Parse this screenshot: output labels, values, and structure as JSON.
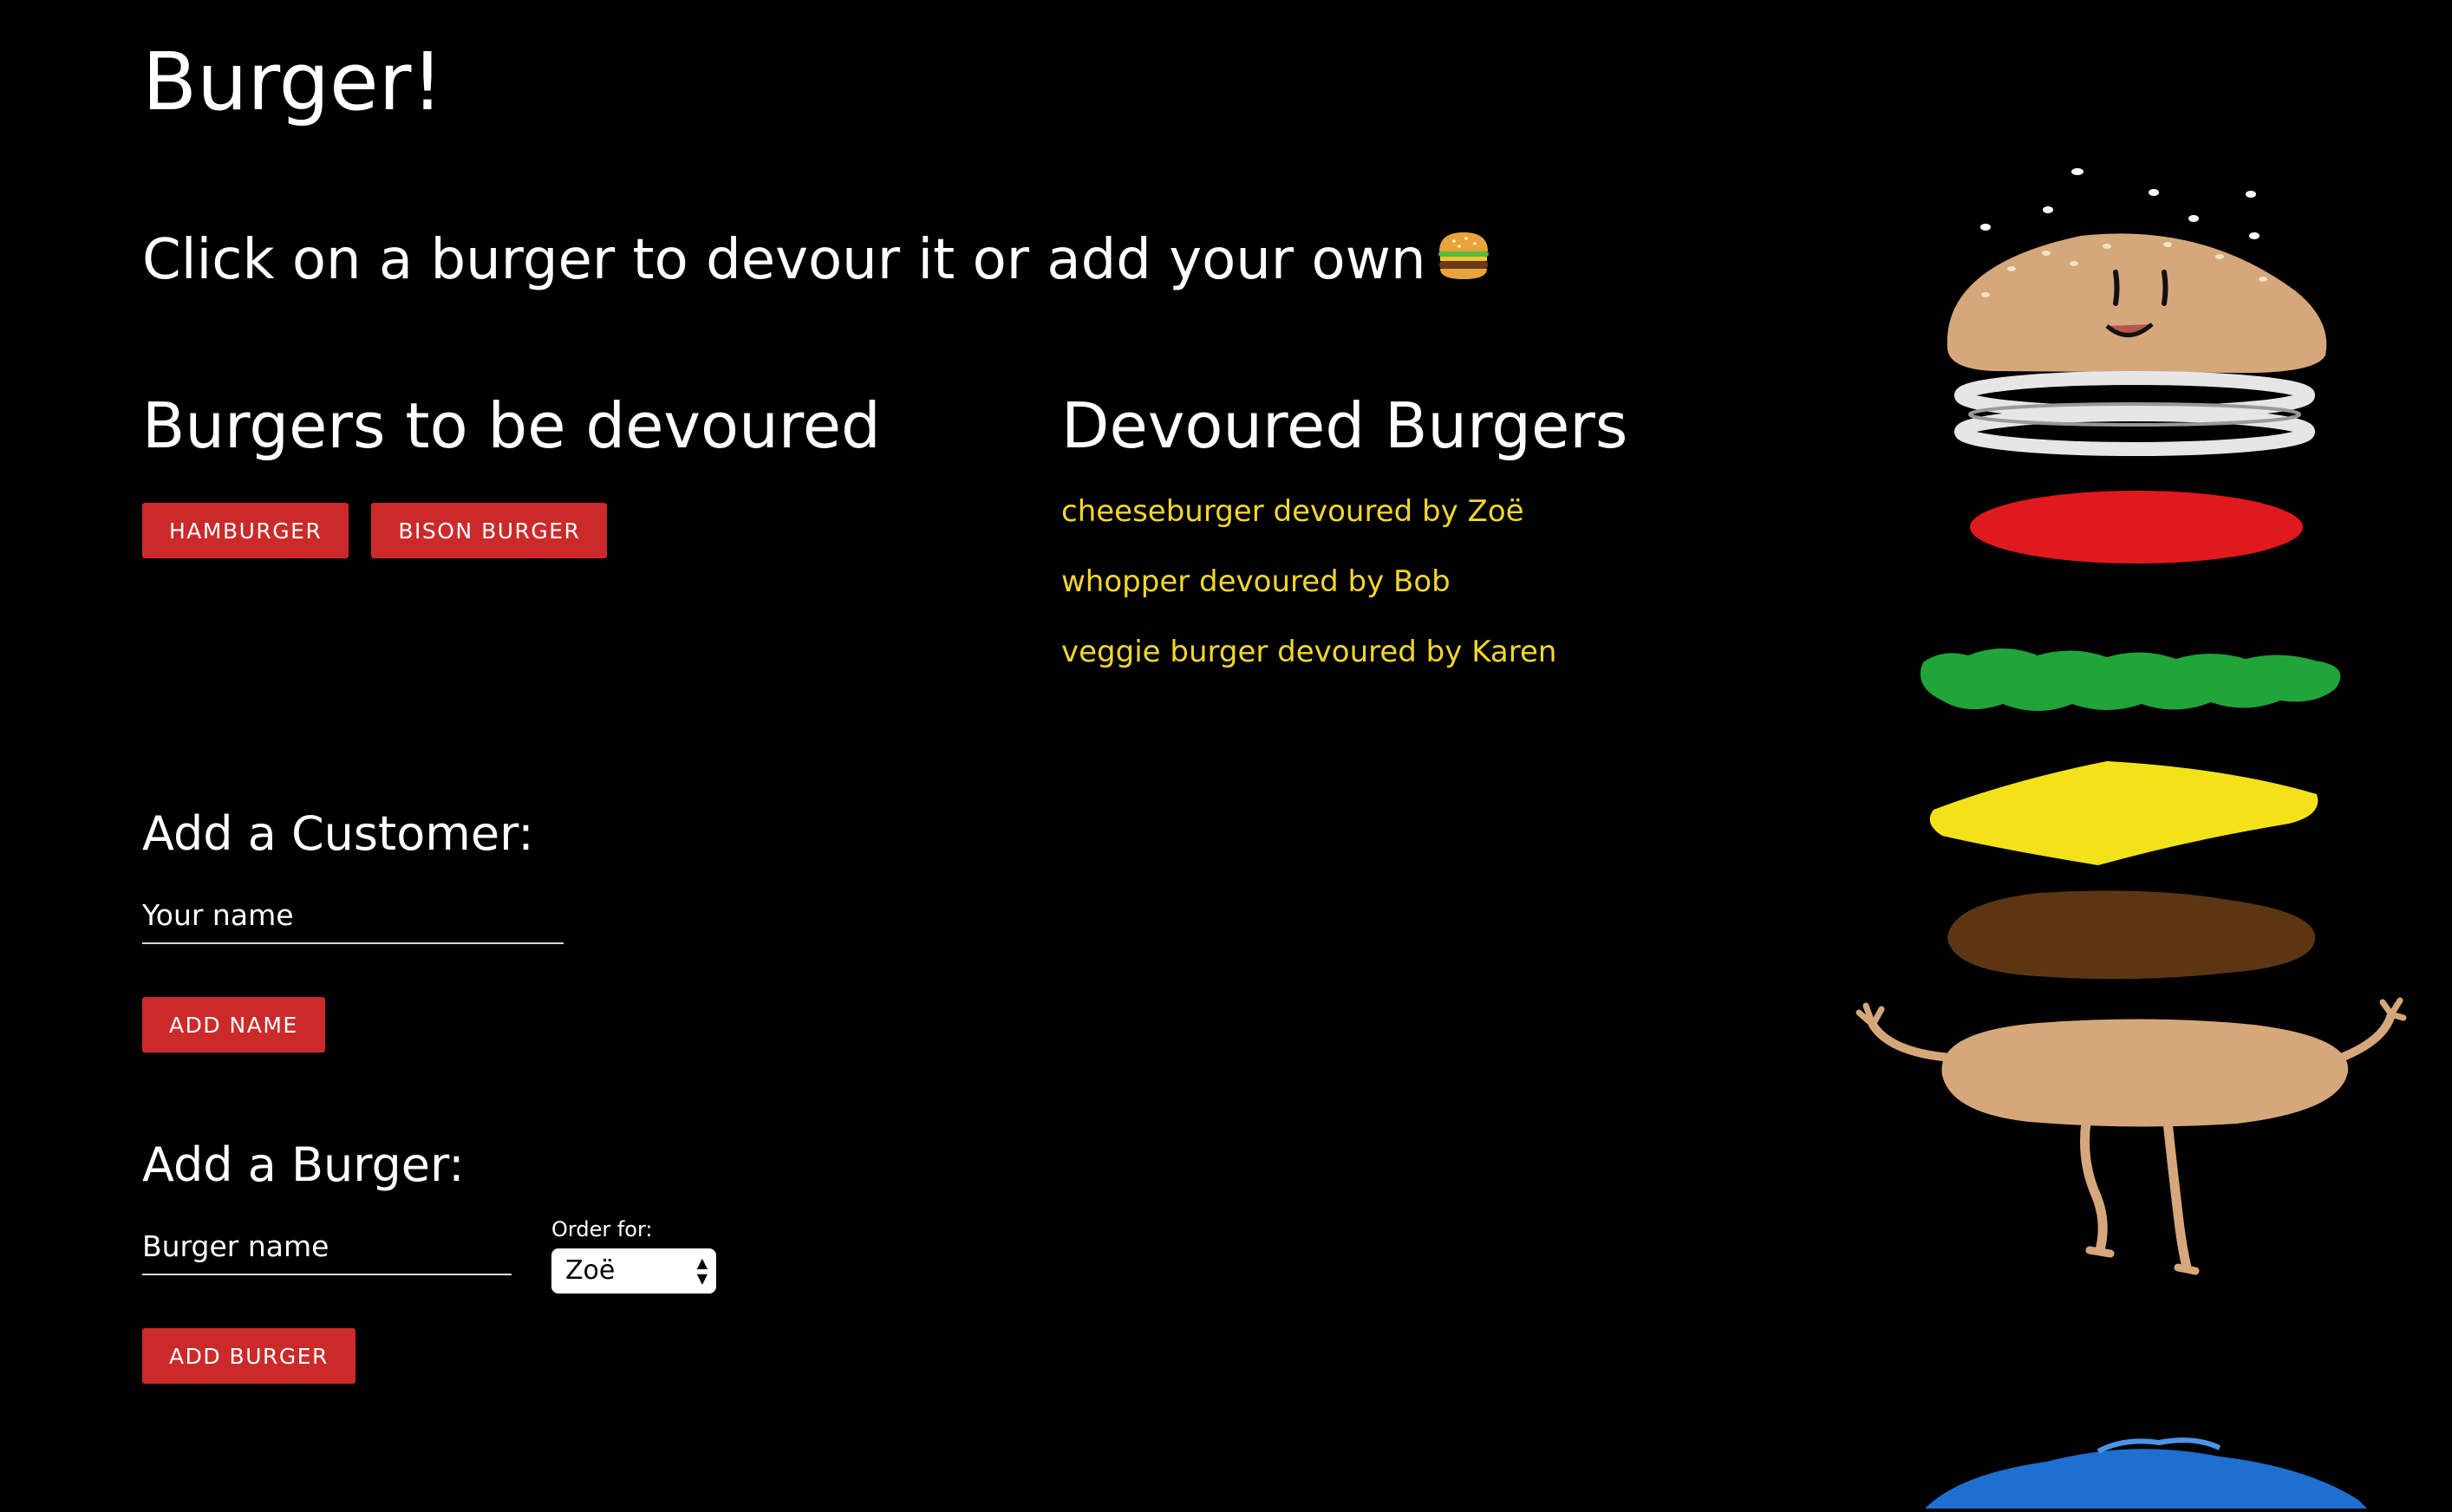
{
  "header": {
    "title": "Burger!",
    "subtitle": "Click on a burger to devour it or add your own"
  },
  "to_devour": {
    "heading": "Burgers to be devoured",
    "burgers": [
      "HAMBURGER",
      "BISON BURGER"
    ]
  },
  "devoured": {
    "heading": "Devoured Burgers",
    "items": [
      "cheeseburger devoured by Zoë",
      "whopper devoured by Bob",
      "veggie burger devoured by Karen"
    ]
  },
  "customer_form": {
    "heading": "Add a Customer:",
    "placeholder": "Your name",
    "button": "ADD NAME"
  },
  "burger_form": {
    "heading": "Add a Burger:",
    "placeholder": "Burger name",
    "order_label": "Order for:",
    "order_selected": "Zoë",
    "button": "ADD BURGER"
  },
  "colors": {
    "background": "#000000",
    "button": "#cc2a2a",
    "devoured_text": "#f2d72c"
  },
  "icons": [
    "hamburger-emoji-icon",
    "burger-illustration"
  ]
}
